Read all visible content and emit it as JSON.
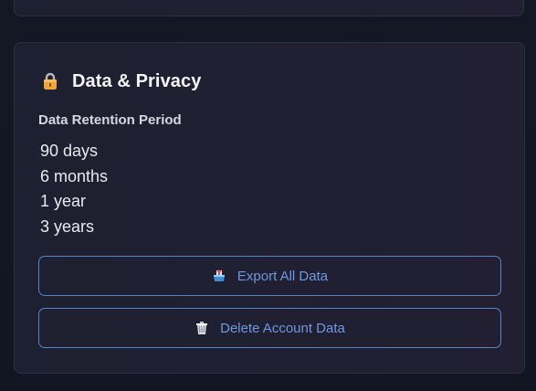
{
  "section": {
    "icon": "lock-icon",
    "title": "Data & Privacy"
  },
  "retention": {
    "label": "Data Retention Period",
    "options": [
      "90 days",
      "6 months",
      "1 year",
      "3 years"
    ]
  },
  "actions": {
    "export": {
      "icon": "outbox-icon",
      "label": "Export All Data"
    },
    "delete": {
      "icon": "trash-icon",
      "label": "Delete Account Data"
    }
  },
  "colors": {
    "background": "#131722",
    "card": "#1f2131",
    "accent": "#6f98e0",
    "title": "#f4f5f8"
  }
}
